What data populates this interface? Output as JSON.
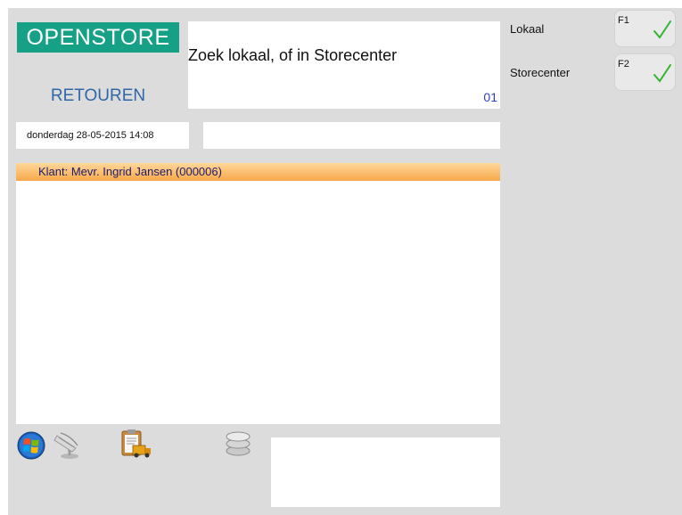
{
  "brand": {
    "logo_text": "OPENSTORE",
    "color": "#16a086"
  },
  "mode": {
    "title": "RETOUREN",
    "color": "#2f67a8"
  },
  "search": {
    "prompt": "Zoek lokaal, of in Storecenter",
    "counter": "01"
  },
  "status": {
    "datetime": "donderdag 28-05-2015 14:08"
  },
  "customer": {
    "header": "Klant: Mevr. Ingrid Jansen (000006)",
    "header_color": "#f7a84a"
  },
  "toolbar": {
    "icons": [
      "windows-icon",
      "network-icon",
      "clipboard-truck-icon",
      "database-icon"
    ]
  },
  "side_options": [
    {
      "label": "Lokaal",
      "key": "F1",
      "checked": true
    },
    {
      "label": "Storecenter",
      "key": "F2",
      "checked": true
    }
  ],
  "colors": {
    "background": "#dcdcdc",
    "check": "#2fb52f"
  }
}
